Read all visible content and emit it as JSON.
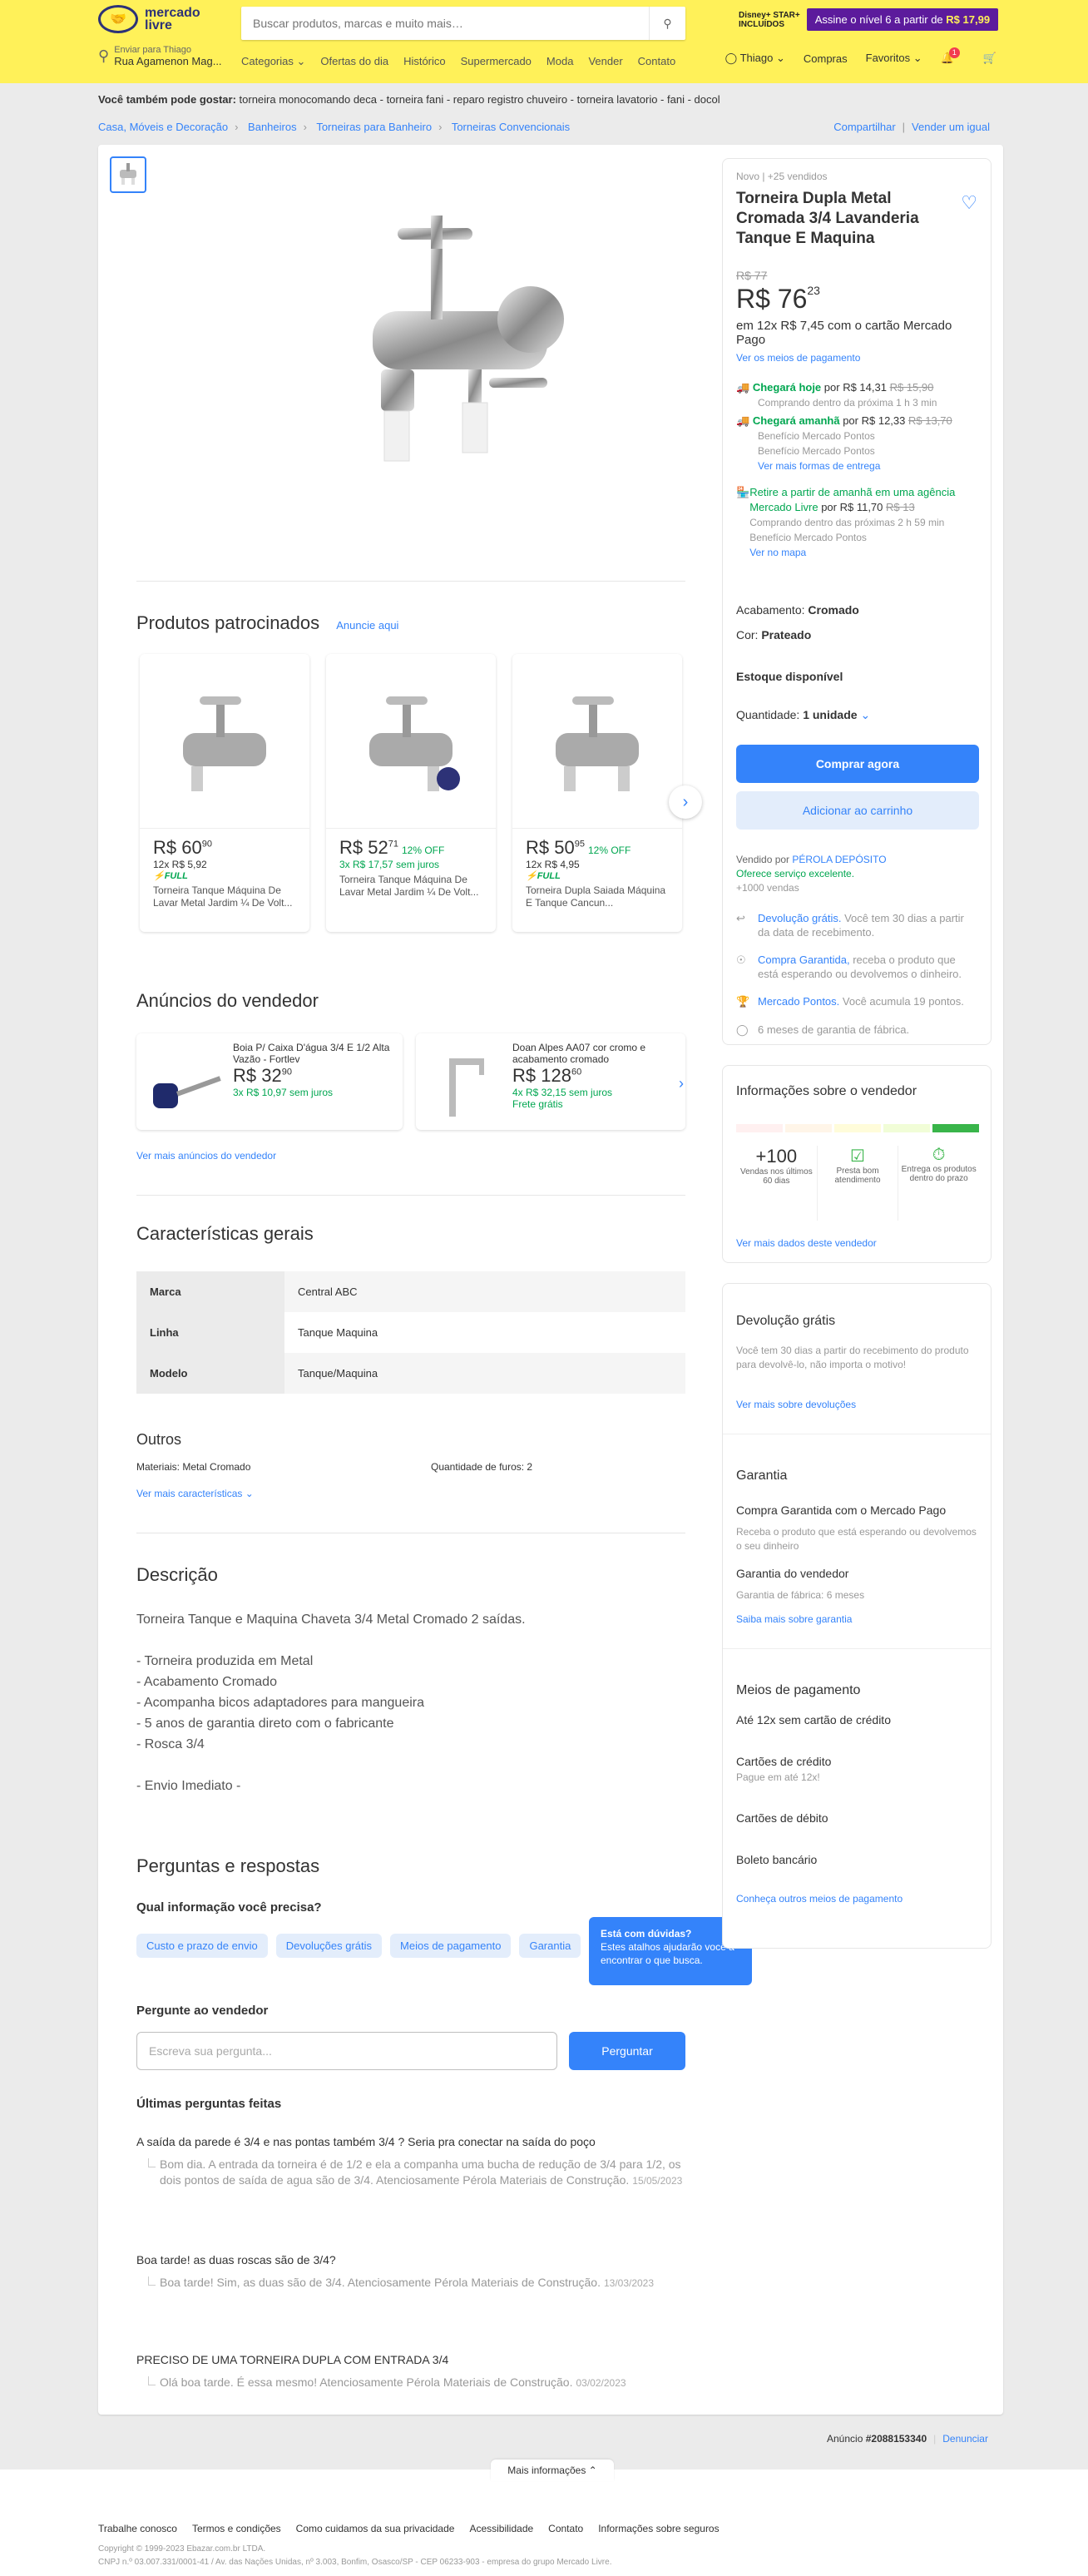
{
  "header": {
    "logo_line1": "mercado",
    "logo_line2": "livre",
    "search_placeholder": "Buscar produtos, marcas e muito mais…",
    "promo_brand": "Disney+ STAR+",
    "promo_brand_sub": "INCLUÍDOS",
    "promo_text": "Assine o nível 6 a partir de",
    "promo_price": "R$ 17,99",
    "address_label": "Enviar para Thiago",
    "address_value": "Rua Agamenon Mag...",
    "nav": [
      "Categorias",
      "Ofertas do dia",
      "Histórico",
      "Supermercado",
      "Moda",
      "Vender",
      "Contato"
    ],
    "user": "Thiago",
    "purchases": "Compras",
    "favorites": "Favoritos",
    "notif_count": "1"
  },
  "also_like": {
    "label": "Você também pode gostar:",
    "items": "torneira monocomando deca - torneira fani - reparo registro chuveiro - torneira lavatorio - fani - docol"
  },
  "breadcrumb": [
    "Casa, Móveis e Decoração",
    "Banheiros",
    "Torneiras para Banheiro",
    "Torneiras Convencionais"
  ],
  "share": "Compartilhar",
  "sell_same": "Vender um igual",
  "product": {
    "condition": "Novo  |  +25 vendidos",
    "title": "Torneira Dupla Metal Cromada 3/4 Lavanderia Tanque E Maquina",
    "old_price": "R$ 77",
    "price": "R$ 76",
    "price_cents": "23",
    "installments": "em 12x R$ 7,45 com o cartão Mercado Pago",
    "payment_link": "Ver os meios de pagamento",
    "ship_today": "Chegará hoje",
    "ship_today_price": "por R$ 14,31",
    "ship_today_old": "R$ 15,90",
    "ship_today_sub": "Comprando dentro da próxima 1 h 3 min",
    "ship_tomorrow": "Chegará amanhã",
    "ship_tomorrow_price": "por R$ 12,33",
    "ship_tomorrow_old": "R$ 13,70",
    "ship_benefit1": "Benefício Mercado Pontos",
    "ship_benefit2": "Benefício Mercado Pontos",
    "ship_more": "Ver mais formas de entrega",
    "pickup": "Retire a partir de amanhã em uma agência Mercado Livre",
    "pickup_price": "por R$ 11,70",
    "pickup_old": "R$ 13",
    "pickup_sub": "Comprando dentro das próximas 2 h 59 min",
    "pickup_benefit": "Benefício Mercado Pontos",
    "pickup_map": "Ver no mapa",
    "finish_label": "Acabamento:",
    "finish_value": "Cromado",
    "color_label": "Cor:",
    "color_value": "Prateado",
    "stock": "Estoque disponível",
    "qty_label": "Quantidade:",
    "qty_value": "1 unidade",
    "buy_now": "Comprar agora",
    "add_cart": "Adicionar ao carrinho",
    "seller_prefix": "Vendido por",
    "seller_name": "PÉROLA DEPÓSITO",
    "seller_service": "Oferece serviço excelente.",
    "seller_sales": "+1000 vendas",
    "return_title": "Devolução grátis.",
    "return_text": "Você tem 30 dias a partir da data de recebimento.",
    "protect_title": "Compra Garantida,",
    "protect_text": "receba o produto que está esperando ou devolvemos o dinheiro.",
    "points_title": "Mercado Pontos.",
    "points_text": "Você acumula 19 pontos.",
    "warranty": "6 meses de garantia de fábrica.",
    "ad_id_label": "Anúncio",
    "ad_id": "#2088153340",
    "report": "Denunciar"
  },
  "sponsored": {
    "title": "Produtos patrocinados",
    "ad_link": "Anuncie aqui",
    "items": [
      {
        "price": "R$ 60",
        "cents": "90",
        "off": "",
        "inst": "12x R$ 5,92",
        "full": "FULL",
        "title": "Torneira Tanque Máquina De Lavar Metal Jardim ¼ De Volt..."
      },
      {
        "price": "R$ 52",
        "cents": "71",
        "off": "12% OFF",
        "inst": "3x R$ 17,57 sem juros",
        "full": "",
        "title": "Torneira Tanque Máquina De Lavar Metal Jardim ¼ De Volt..."
      },
      {
        "price": "R$ 50",
        "cents": "95",
        "off": "12% OFF",
        "inst": "12x R$ 4,95",
        "full": "FULL",
        "title": "Torneira Dupla Saiada Máquina E Tanque Cancun..."
      }
    ]
  },
  "seller_ads": {
    "title": "Anúncios do vendedor",
    "items": [
      {
        "title": "Boia P/ Caixa D'água 3/4 E 1/2 Alta Vazão - Fortlev",
        "price": "R$ 32",
        "cents": "90",
        "inst": "3x R$ 10,97 sem juros",
        "ship": ""
      },
      {
        "title": "Doan Alpes AA07 cor cromo e acabamento cromado",
        "price": "R$ 128",
        "cents": "60",
        "inst": "4x R$ 32,15 sem juros",
        "ship": "Frete grátis"
      }
    ],
    "more": "Ver mais anúncios do vendedor"
  },
  "specs": {
    "title": "Características gerais",
    "rows": [
      {
        "k": "Marca",
        "v": "Central ABC"
      },
      {
        "k": "Linha",
        "v": "Tanque Maquina"
      },
      {
        "k": "Modelo",
        "v": "Tanque/Maquina"
      }
    ],
    "others_title": "Outros",
    "material_label": "Materiais:",
    "material_value": "Metal Cromado",
    "holes_label": "Quantidade de furos:",
    "holes_value": "2",
    "more": "Ver mais características"
  },
  "description": {
    "title": "Descrição",
    "text": "Torneira Tanque e Maquina Chaveta 3/4 Metal Cromado 2 saídas.\n\n- Torneira produzida em Metal\n- Acabamento Cromado\n- Acompanha bicos adaptadores para mangueira\n- 5 anos de garantia direto com o fabricante\n- Rosca 3/4\n\n- Envio Imediato -"
  },
  "qa": {
    "title": "Perguntas e respostas",
    "prompt": "Qual informação você precisa?",
    "chips": [
      "Custo e prazo de envio",
      "Devoluções grátis",
      "Meios de pagamento",
      "Garantia"
    ],
    "tip_title": "Está com dúvidas?",
    "tip_text": "Estes atalhos ajudarão você a encontrar o que busca.",
    "ask_label": "Pergunte ao vendedor",
    "ask_placeholder": "Escreva sua pergunta...",
    "ask_button": "Perguntar",
    "last_title": "Últimas perguntas feitas",
    "items": [
      {
        "q": "A saída da parede é 3/4 e nas pontas também 3/4 ? Seria pra conectar na saída do poço",
        "a": "Bom dia. A entrada da torneira é de 1/2 e ela a companha uma bucha de redução de 3/4 para 1/2, os dois pontos de saída de agua são de 3/4. Atenciosamente Pérola Materiais de Construção.",
        "d": "15/05/2023"
      },
      {
        "q": "Boa tarde! as duas roscas são de 3/4?",
        "a": "Boa tarde! Sim, as duas são de 3/4. Atenciosamente Pérola Materiais de Construção.",
        "d": "13/03/2023"
      },
      {
        "q": "PRECISO DE UMA TORNEIRA DUPLA COM ENTRADA 3/4",
        "a": "Olá boa tarde. É essa mesmo! Atenciosamente Pérola Materiais de Construção.",
        "d": "03/02/2023"
      }
    ]
  },
  "seller_info": {
    "title": "Informações sobre o vendedor",
    "sales_value": "+100",
    "sales_label": "Vendas nos últimos 60 dias",
    "service_label": "Presta bom atendimento",
    "delivery_label": "Entrega os produtos dentro do prazo",
    "more": "Ver mais dados deste vendedor"
  },
  "returns": {
    "title": "Devolução grátis",
    "text": "Você tem 30 dias a partir do recebimento do produto para devolvê-lo, não importa o motivo!",
    "more": "Ver mais sobre devoluções"
  },
  "warranty": {
    "title": "Garantia",
    "protect": "Compra Garantida com o Mercado Pago",
    "protect_text": "Receba o produto que está esperando ou devolvemos o seu dinheiro",
    "seller": "Garantia do vendedor",
    "seller_text": "Garantia de fábrica: 6 meses",
    "more": "Saiba mais sobre garantia"
  },
  "payment": {
    "title": "Meios de pagamento",
    "installments": "Até 12x sem cartão de crédito",
    "credit": "Cartões de crédito",
    "credit_sub": "Pague em até 12x!",
    "debit": "Cartões de débito",
    "boleto": "Boleto bancário",
    "more": "Conheça outros meios de pagamento"
  },
  "footer": {
    "more_info": "Mais informações",
    "links": [
      "Trabalhe conosco",
      "Termos e condições",
      "Como cuidamos da sua privacidade",
      "Acessibilidade",
      "Contato",
      "Informações sobre seguros"
    ],
    "copyright": "Copyright © 1999-2023 Ebazar.com.br LTDA.",
    "address": "CNPJ n.º 03.007.331/0001-41 / Av. das Nações Unidas, nº 3.003, Bonfim, Osasco/SP - CEP 06233-903 - empresa do grupo Mercado Livre."
  },
  "colors": {
    "brand_yellow": "#fff159",
    "primary": "#3483fa",
    "green": "#00a650"
  }
}
